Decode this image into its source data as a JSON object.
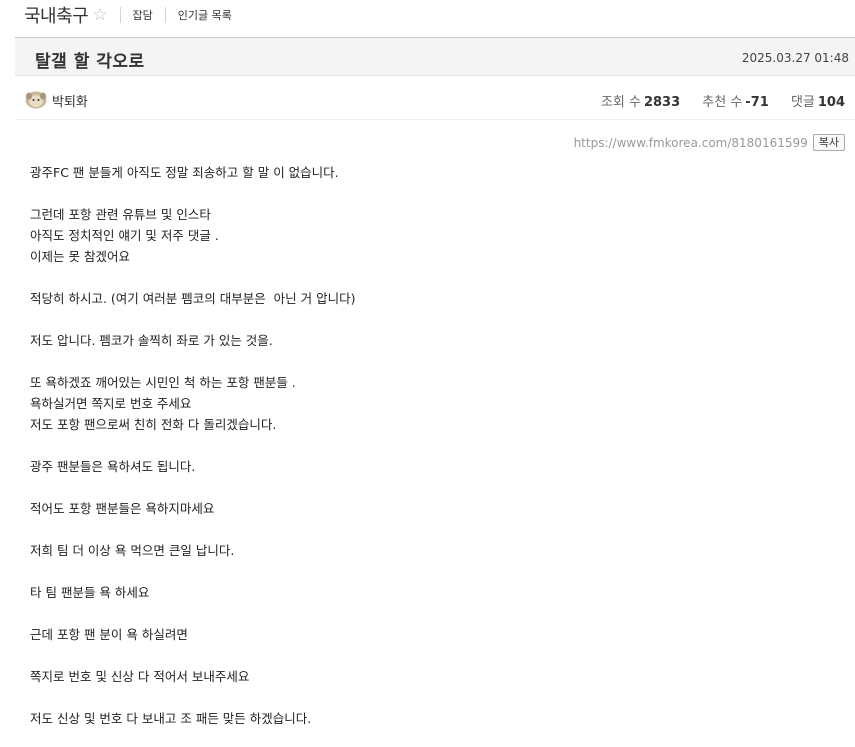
{
  "board": {
    "title": "국내축구",
    "star_icon": "star-outline-icon",
    "nav": [
      "잡담",
      "인기글 목록"
    ]
  },
  "post": {
    "title": "탈갤 할 각오로",
    "date": "2025.03.27 01:48",
    "author": "박퇴화",
    "avatar_icon": "avatar-icon",
    "stats": {
      "views_label": "조회 수",
      "views": "2833",
      "votes_label": "추천 수",
      "votes": "-71",
      "comments_label": "댓글",
      "comments": "104"
    },
    "url": "https://www.fmkorea.com/8180161599",
    "copy_label": "복사",
    "body": [
      "광주FC 팬 분들게 아직도 정말 죄송하고 할 말 이 없습니다.",
      "",
      "그런데 포항 관련 유튜브 및 인스타",
      "아직도 정치적인 얘기 및 저주 댓글 .",
      "이제는 못 참겠어요",
      "",
      "적당히 하시고. (여기 여러분 펨코의 대부분은  아닌 거 압니다)",
      "",
      "저도 압니다. 펨코가 솔찍히 좌로 가 있는 것을.",
      "",
      "또 욕하겠죠 깨어있는 시민인 척 하는 포항 팬분들 .",
      "욕하실거면 쪽지로 번호 주세요",
      "저도 포항 팬으로써 친히 전화 다 돌리겠습니다.",
      "",
      "광주 팬분들은 욕하셔도 됩니다.",
      "",
      "적어도 포항 팬분들은 욕하지마세요",
      "",
      "저희 팀 더 이상 욕 먹으면 큰일 납니다.",
      "",
      "타 팀 팬분들 욕 하세요",
      "",
      "근데 포항 팬 분이 욕 하실려면",
      "",
      "쪽지로 번호 및 신상 다 적어서 보내주세요",
      "",
      "저도 신상 및 번호 다 보내고 조 패든 맞든 하겠습니다."
    ]
  }
}
